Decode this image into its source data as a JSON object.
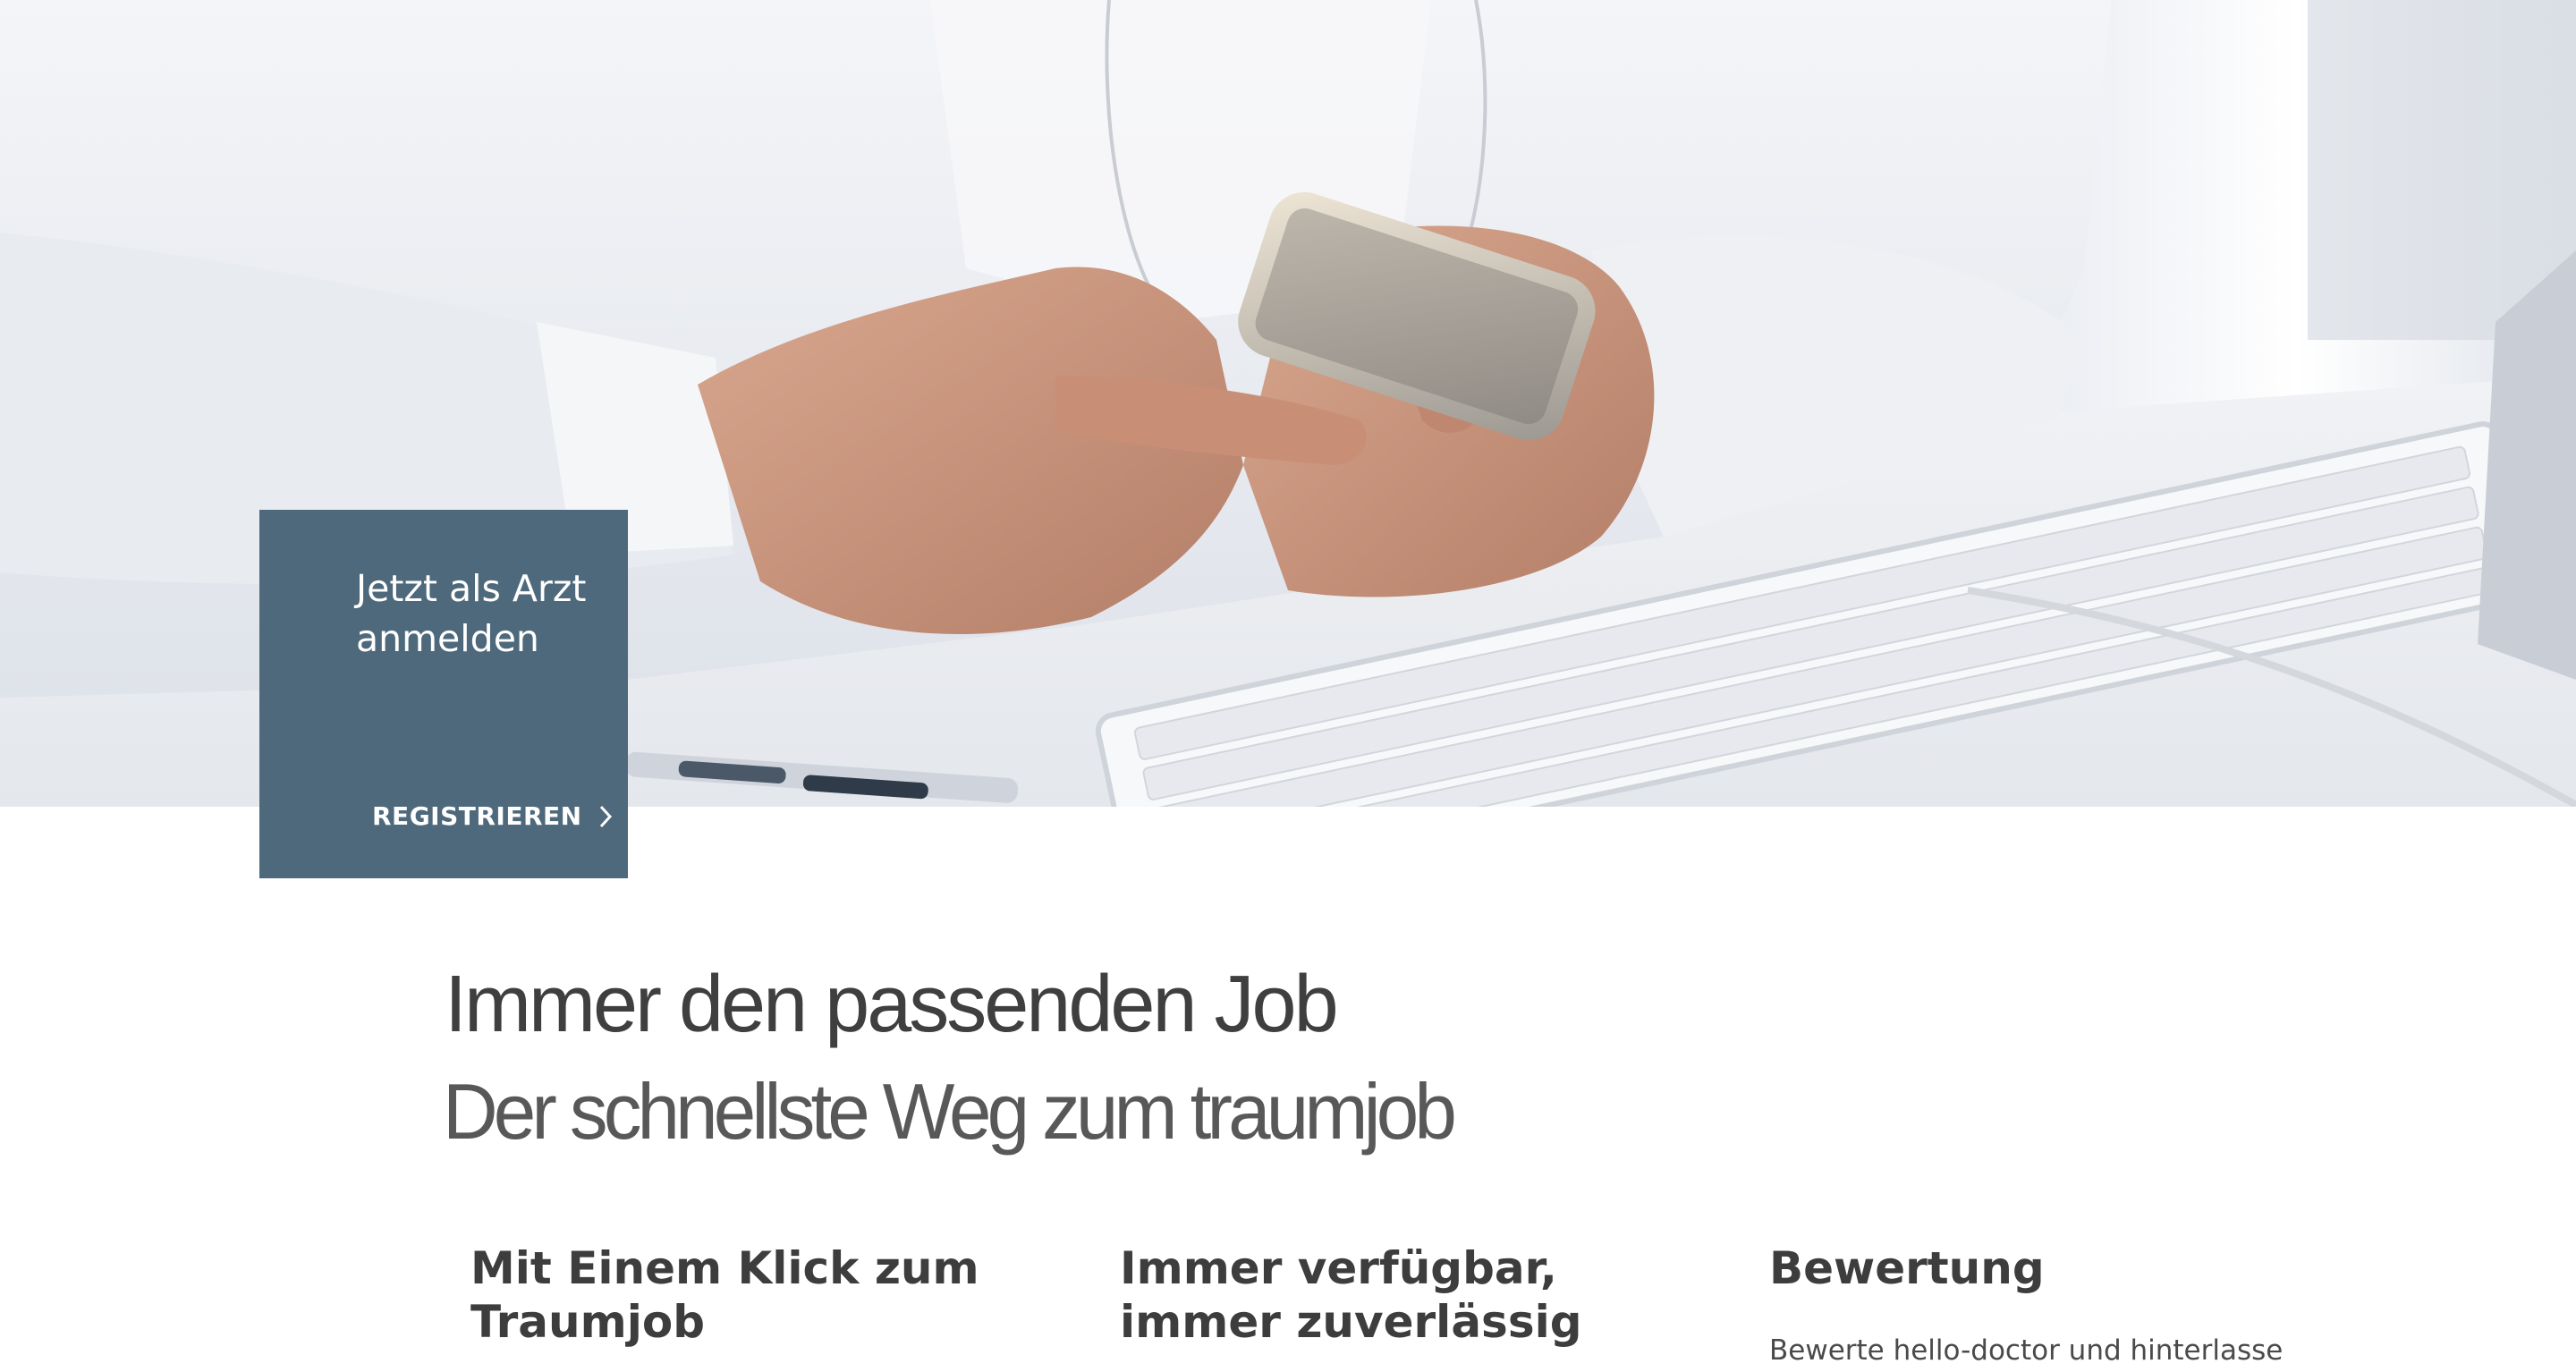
{
  "hero": {
    "image_icon": "doctor-with-smartphone-photo"
  },
  "cta": {
    "title": "Jetzt als Arzt anmelden",
    "link_label": "REGISTRIEREN",
    "arrow_icon": "chevron-right-icon",
    "background_color": "#4e697b"
  },
  "intro": {
    "headline": "Immer den passenden Job",
    "subheadline": "Der schnellste Weg zum traumjob"
  },
  "features": [
    {
      "title": "Mit Einem Klick zum Traumjob",
      "text": ""
    },
    {
      "title": "Immer verfügbar, immer zuverlässig",
      "text": ""
    },
    {
      "title": "Bewertung",
      "text": "Bewerte hello-doctor und hinterlasse"
    }
  ]
}
